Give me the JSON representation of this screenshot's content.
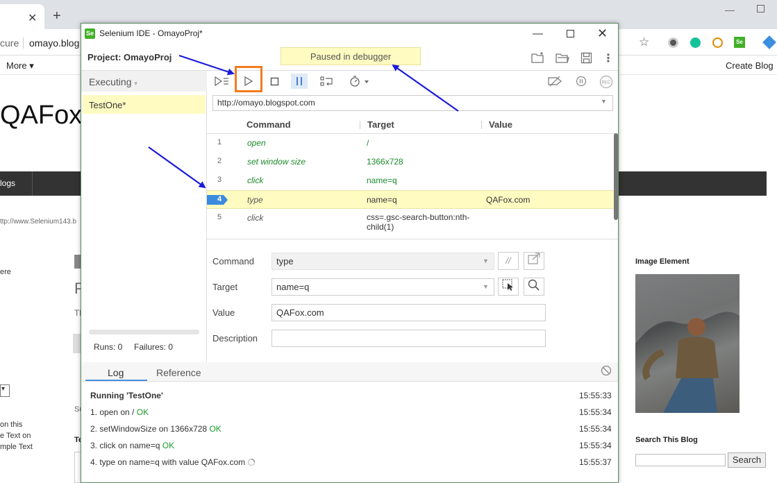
{
  "browser": {
    "secure_text": "cure",
    "url": "omayo.blog",
    "bookmarks_more": "More ▾",
    "create_blog": "Create Blog",
    "tab_close": "✕",
    "new_tab": "+",
    "minimize": "—"
  },
  "page": {
    "site_title": "QAFox",
    "nav_item": "logs",
    "page_url": "ttp://www.Selenium143.b",
    "ere_text": "ere",
    "big_p": "P",
    "tl_text": "Tl",
    "select_arrow": "▾",
    "on_this_lines": [
      "on this",
      "e Text on",
      "mple Text"
    ],
    "su_text": "Su",
    "te_text": "Te",
    "image_element_label": "Image Element",
    "search_blog_label": "Search This Blog",
    "search_button": "Search"
  },
  "ide": {
    "logo": "Se",
    "title": "Selenium IDE - OmayoProj*",
    "minimize": "—",
    "close": "✕",
    "project_label": "Project:  OmayoProj",
    "status_banner": "Paused in debugger",
    "sidebar": {
      "header": "Executing",
      "header_chevron": "▾",
      "tests": [
        {
          "name": "TestOne*"
        }
      ],
      "runs": "Runs: 0",
      "failures": "Failures: 0"
    },
    "toolbar_icons": {
      "run_all": "run-all-icon",
      "run_current": "play-icon",
      "stop": "stop-icon",
      "pause": "pause-icon",
      "step_over": "step-over-icon",
      "speed": "speed-icon",
      "disable_breakpoints": "disable-breakpoints-icon",
      "pause_on_exceptions": "pause-on-exceptions-icon",
      "record": "record-icon",
      "record_label": "REC"
    },
    "base_url": "http://omayo.blogspot.com",
    "columns": {
      "command": "Command",
      "target": "Target",
      "value": "Value"
    },
    "commands": [
      {
        "num": "1",
        "command": "open",
        "target": "/",
        "value": ""
      },
      {
        "num": "2",
        "command": "set window size",
        "target": "1366x728",
        "value": ""
      },
      {
        "num": "3",
        "command": "click",
        "target": "name=q",
        "value": ""
      },
      {
        "num": "4",
        "command": "type",
        "target": "name=q",
        "value": "QAFox.com"
      },
      {
        "num": "5",
        "command": "click",
        "target": "css=.gsc-search-button:nth-",
        "target2": "child(1)",
        "value": ""
      }
    ],
    "detail": {
      "command_label": "Command",
      "command_value": "type",
      "target_label": "Target",
      "target_value": "name=q",
      "value_label": "Value",
      "value_value": "QAFox.com",
      "description_label": "Description",
      "description_value": "",
      "comment_icon_label": "//"
    },
    "log": {
      "tab_log": "Log",
      "tab_reference": "Reference",
      "header": "Running 'TestOne'",
      "header_time": "15:55:33",
      "entries": [
        {
          "text": "1.   open on / ",
          "status": "OK",
          "time": "15:55:34"
        },
        {
          "text": "2.   setWindowSize on 1366x728 ",
          "status": "OK",
          "time": "15:55:34"
        },
        {
          "text": "3.   click on name=q ",
          "status": "OK",
          "time": "15:55:34"
        },
        {
          "text": "4.   type on name=q with value QAFox.com ",
          "status": "",
          "time": "15:55:37"
        }
      ]
    }
  },
  "colors": {
    "accent_orange": "#f27c1f",
    "highlight_yellow": "#fffbc1",
    "command_green": "#1a8a2a",
    "ok_green": "#1a9c2c",
    "annotation_arrow": "#1a1adb"
  }
}
